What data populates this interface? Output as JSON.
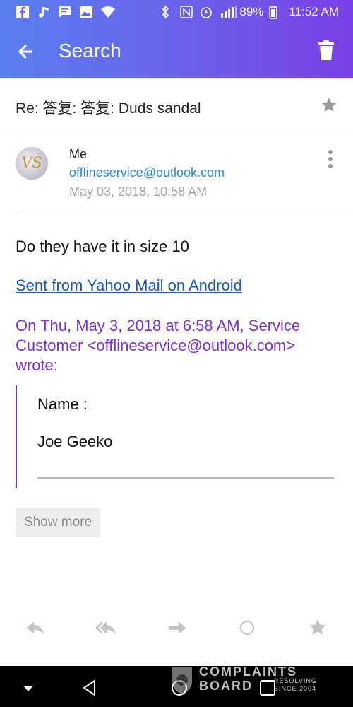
{
  "status_bar": {
    "battery": "89%",
    "time": "11:52 AM"
  },
  "header": {
    "title": "Search"
  },
  "email": {
    "subject": "Re: 答复: 答复: Duds sandal",
    "avatar_initials": "VS",
    "sender_name": "Me",
    "sender_email": "offlineservice@outlook.com",
    "date": "May 03, 2018, 10:58 AM",
    "body_text": "Do they have it in size 10",
    "signature_link": "Sent from Yahoo Mail on Android",
    "quote_header": "On Thu, May 3, 2018 at 6:58 AM, Service Customer <offlineservice@outlook.com> wrote:",
    "quote": {
      "name_label": "Name :",
      "name_value": "Joe Geeko"
    },
    "show_more_label": "Show more"
  },
  "action_bar": {
    "icons": [
      "reply-icon",
      "reply-all-icon",
      "forward-icon",
      "mark-unread-icon",
      "star-icon"
    ]
  },
  "watermark": {
    "line1": "COMPLAINTS",
    "line2": "BOARD",
    "line3": "RESOLVING SINCE 2004"
  },
  "colors": {
    "header_gradient_start": "#5a7ff0",
    "header_gradient_end": "#7a3fe6",
    "link_blue": "#1a56c4",
    "email_blue": "#2a86d4",
    "quote_purple": "#7b2fd6"
  }
}
